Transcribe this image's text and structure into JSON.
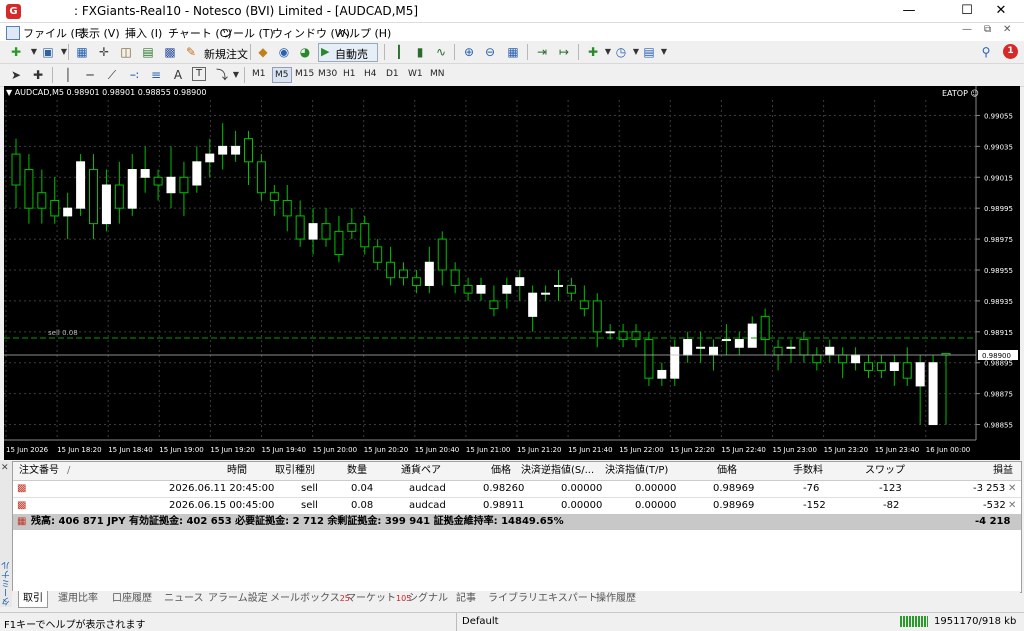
{
  "window": {
    "title": ": FXGiants-Real10 - Notesco (BVI) Limited - [AUDCAD,M5]"
  },
  "menu": [
    "ファイル (F)",
    "表示 (V)",
    "挿入 (I)",
    "チャート (C)",
    "ツール (T)",
    "ウィンドウ (W)",
    "ヘルプ (H)"
  ],
  "toolbar": {
    "new_order": "新規注文",
    "auto_trade": "自動売買"
  },
  "notification_count": "1",
  "timeframes": [
    "M1",
    "M5",
    "M15",
    "M30",
    "H1",
    "H4",
    "D1",
    "W1",
    "MN"
  ],
  "chart": {
    "header": "AUDCAD,M5  0.98901 0.98901 0.98855 0.98900",
    "ea": "EATOP",
    "order_line_label": "sell 0.08",
    "current_price": "0.98900",
    "y_ticks": [
      "0.99055",
      "0.99035",
      "0.99015",
      "0.98995",
      "0.98975",
      "0.98955",
      "0.98935",
      "0.98915",
      "0.98895",
      "0.98875",
      "0.98855"
    ],
    "x_ticks": [
      "15 Jun 2026",
      "15 Jun 18:20",
      "15 Jun 18:40",
      "15 Jun 19:00",
      "15 Jun 19:20",
      "15 Jun 19:40",
      "15 Jun 20:00",
      "15 Jun 20:20",
      "15 Jun 20:40",
      "15 Jun 21:00",
      "15 Jun 21:20",
      "15 Jun 21:40",
      "15 Jun 22:00",
      "15 Jun 22:20",
      "15 Jun 22:40",
      "15 Jun 23:00",
      "15 Jun 23:20",
      "15 Jun 23:40",
      "16 Jun 00:00"
    ]
  },
  "chart_data": {
    "type": "candlestick",
    "title": "AUDCAD,M5",
    "ylim": [
      0.98845,
      0.99065
    ],
    "candles_ohlc": [
      [
        0.9903,
        0.9904,
        0.98995,
        0.9901
      ],
      [
        0.9902,
        0.9903,
        0.98985,
        0.98995
      ],
      [
        0.99005,
        0.9902,
        0.98985,
        0.98995
      ],
      [
        0.99,
        0.99015,
        0.98985,
        0.9899
      ],
      [
        0.9899,
        0.99005,
        0.98975,
        0.98995
      ],
      [
        0.98995,
        0.9903,
        0.9899,
        0.99025
      ],
      [
        0.9902,
        0.9903,
        0.98975,
        0.98985
      ],
      [
        0.98985,
        0.9902,
        0.9898,
        0.9901
      ],
      [
        0.9901,
        0.99025,
        0.98985,
        0.98995
      ],
      [
        0.98995,
        0.9903,
        0.9899,
        0.9902
      ],
      [
        0.99015,
        0.99035,
        0.99005,
        0.9902
      ],
      [
        0.99015,
        0.9902,
        0.99,
        0.9901
      ],
      [
        0.99005,
        0.99035,
        0.98995,
        0.99015
      ],
      [
        0.99015,
        0.99025,
        0.9899,
        0.99005
      ],
      [
        0.9901,
        0.99035,
        0.99005,
        0.99025
      ],
      [
        0.99025,
        0.9904,
        0.99015,
        0.9903
      ],
      [
        0.9903,
        0.9905,
        0.9902,
        0.99035
      ],
      [
        0.9903,
        0.99045,
        0.99025,
        0.99035
      ],
      [
        0.9904,
        0.99045,
        0.9901,
        0.99025
      ],
      [
        0.99025,
        0.9903,
        0.99,
        0.99005
      ],
      [
        0.99005,
        0.9901,
        0.9899,
        0.99
      ],
      [
        0.99,
        0.9901,
        0.9898,
        0.9899
      ],
      [
        0.9899,
        0.99,
        0.9897,
        0.98975
      ],
      [
        0.98975,
        0.98995,
        0.98965,
        0.98985
      ],
      [
        0.98985,
        0.98995,
        0.9897,
        0.98975
      ],
      [
        0.9898,
        0.9899,
        0.9896,
        0.98965
      ],
      [
        0.98985,
        0.98995,
        0.98975,
        0.9898
      ],
      [
        0.98985,
        0.9899,
        0.98965,
        0.9897
      ],
      [
        0.9897,
        0.98975,
        0.98955,
        0.9896
      ],
      [
        0.9896,
        0.9897,
        0.98945,
        0.9895
      ],
      [
        0.98955,
        0.9896,
        0.98945,
        0.9895
      ],
      [
        0.9895,
        0.98955,
        0.9894,
        0.98945
      ],
      [
        0.98945,
        0.9897,
        0.9894,
        0.9896
      ],
      [
        0.98975,
        0.9898,
        0.98945,
        0.98955
      ],
      [
        0.98955,
        0.9896,
        0.9894,
        0.98945
      ],
      [
        0.98945,
        0.9895,
        0.98935,
        0.9894
      ],
      [
        0.9894,
        0.9895,
        0.98935,
        0.98945
      ],
      [
        0.98935,
        0.98945,
        0.98925,
        0.9893
      ],
      [
        0.9894,
        0.9895,
        0.9893,
        0.98945
      ],
      [
        0.98945,
        0.98955,
        0.98935,
        0.9895
      ],
      [
        0.98925,
        0.98945,
        0.98915,
        0.9894
      ],
      [
        0.9894,
        0.98945,
        0.98935,
        0.9894
      ],
      [
        0.98945,
        0.98955,
        0.98935,
        0.98945
      ],
      [
        0.98945,
        0.9895,
        0.98935,
        0.9894
      ],
      [
        0.98935,
        0.98945,
        0.98925,
        0.9893
      ],
      [
        0.98935,
        0.9894,
        0.98905,
        0.98915
      ],
      [
        0.98915,
        0.9892,
        0.9891,
        0.98915
      ],
      [
        0.98915,
        0.9892,
        0.98905,
        0.9891
      ],
      [
        0.98915,
        0.9892,
        0.98905,
        0.9891
      ],
      [
        0.9891,
        0.98915,
        0.9888,
        0.98885
      ],
      [
        0.98885,
        0.98895,
        0.9888,
        0.9889
      ],
      [
        0.98885,
        0.9891,
        0.9888,
        0.98905
      ],
      [
        0.989,
        0.98915,
        0.98895,
        0.9891
      ],
      [
        0.98905,
        0.98915,
        0.98895,
        0.98905
      ],
      [
        0.989,
        0.9891,
        0.9889,
        0.98905
      ],
      [
        0.9891,
        0.9892,
        0.989,
        0.9891
      ],
      [
        0.98905,
        0.98915,
        0.989,
        0.9891
      ],
      [
        0.98905,
        0.98925,
        0.98905,
        0.9892
      ],
      [
        0.98925,
        0.9893,
        0.989,
        0.9891
      ],
      [
        0.98905,
        0.9891,
        0.9889,
        0.989
      ],
      [
        0.98905,
        0.9891,
        0.98895,
        0.98905
      ],
      [
        0.9891,
        0.98915,
        0.98895,
        0.989
      ],
      [
        0.989,
        0.98905,
        0.9889,
        0.98895
      ],
      [
        0.989,
        0.9891,
        0.98895,
        0.98905
      ],
      [
        0.989,
        0.98905,
        0.98885,
        0.98895
      ],
      [
        0.98895,
        0.98905,
        0.9889,
        0.989
      ],
      [
        0.98895,
        0.989,
        0.98885,
        0.9889
      ],
      [
        0.98895,
        0.989,
        0.98885,
        0.9889
      ],
      [
        0.9889,
        0.989,
        0.9888,
        0.98895
      ],
      [
        0.98895,
        0.98905,
        0.9888,
        0.98885
      ],
      [
        0.9888,
        0.989,
        0.98855,
        0.98895
      ],
      [
        0.98855,
        0.989,
        0.98855,
        0.98895
      ],
      [
        0.98901,
        0.98901,
        0.98855,
        0.989
      ]
    ]
  },
  "terminal": {
    "side_label": "ターミナル",
    "columns": [
      "注文番号",
      "/",
      "時間",
      "取引種別",
      "数量",
      "通貨ペア",
      "価格",
      "決済逆指値(S/...",
      "決済指値(T/P)",
      "価格",
      "手数料",
      "スワップ",
      "損益"
    ],
    "rows": [
      [
        "",
        "",
        "2026.06.11 20:45:00",
        "sell",
        "0.04",
        "audcad",
        "0.98260",
        "0.00000",
        "0.00000",
        "0.98969",
        "-76",
        "-123",
        "-3 253"
      ],
      [
        "",
        "",
        "2026.06.15 00:45:00",
        "sell",
        "0.08",
        "audcad",
        "0.98911",
        "0.00000",
        "0.00000",
        "0.98969",
        "-152",
        "-82",
        "-532"
      ]
    ],
    "summary": "残高: 406 871 JPY  有効証拠金: 402 653  必要証拠金: 2 712  余剰証拠金: 399 941  証拠金維持率: 14849.65%",
    "summary_total": "-4 218",
    "tabs": [
      {
        "label": "取引",
        "active": true
      },
      {
        "label": "運用比率"
      },
      {
        "label": "口座履歴"
      },
      {
        "label": "ニュース"
      },
      {
        "label": "アラーム設定"
      },
      {
        "label": "メールボックス",
        "badge": "25"
      },
      {
        "label": "マーケット",
        "badge": "105"
      },
      {
        "label": "シグナル"
      },
      {
        "label": "記事"
      },
      {
        "label": "ライブラリ"
      },
      {
        "label": "エキスパート"
      },
      {
        "label": "操作履歴"
      }
    ]
  },
  "status": {
    "help": "F1キーでヘルプが表示されます",
    "profile": "Default",
    "traffic": "1951170/918 kb"
  },
  "colors": {
    "chart_bg": "#000000",
    "bull": "#ffffff",
    "bear": "#00c000",
    "grid": "#3c3c3c",
    "order_line": "#00a000"
  }
}
